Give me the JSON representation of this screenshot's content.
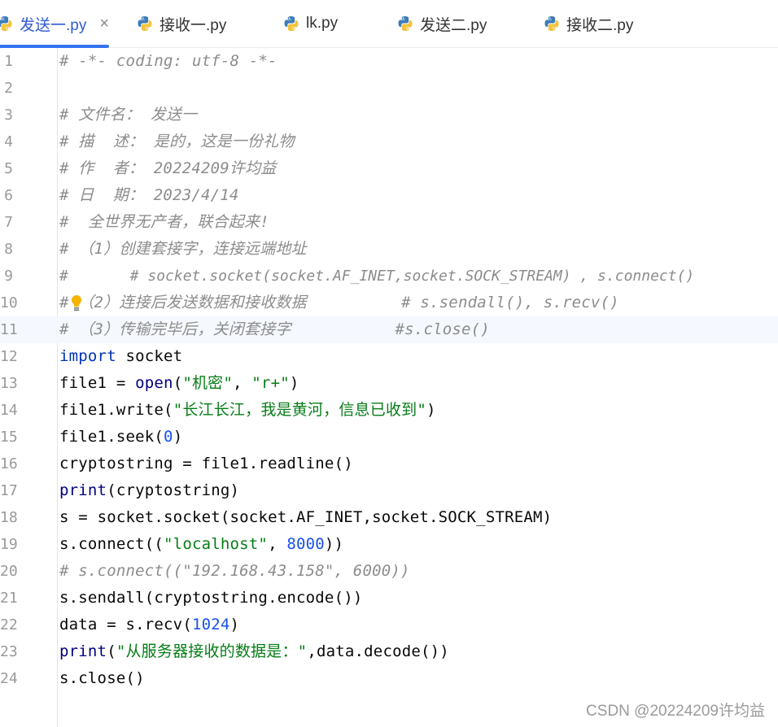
{
  "tabs": [
    {
      "label": "发送一.py",
      "active": true,
      "close": "×"
    },
    {
      "label": "接收一.py",
      "active": false
    },
    {
      "label": "lk.py",
      "active": false
    },
    {
      "label": "发送二.py",
      "active": false
    },
    {
      "label": "接收二.py",
      "active": false
    }
  ],
  "lines": [
    {
      "n": "1",
      "text": "# -*- coding: utf-8 -*-"
    },
    {
      "n": "2",
      "text": ""
    },
    {
      "n": "3",
      "text": "# 文件名： 发送一"
    },
    {
      "n": "4",
      "text": "# 描  述： 是的，这是一份礼物"
    },
    {
      "n": "5",
      "text": "# 作  者： 20224209许均益"
    },
    {
      "n": "6",
      "text": "# 日  期： 2023/4/14"
    },
    {
      "n": "7",
      "text": "#  全世界无产者，联合起来!"
    },
    {
      "n": "8",
      "text": "# （1）创建套接字，连接远端地址"
    },
    {
      "n": "9",
      "text": "#       # socket.socket(socket.AF_INET,socket.SOCK_STREAM) , s.connect()"
    },
    {
      "n": "10",
      "text": "# （2）连接后发送数据和接收数据          # s.sendall(), s.recv()"
    },
    {
      "n": "11",
      "text": "# （3）传输完毕后，关闭套接字           #s.close()"
    },
    {
      "n": "12",
      "text": "import socket"
    },
    {
      "n": "13",
      "text": "file1 = open(\"机密\", \"r+\")"
    },
    {
      "n": "14",
      "text": "file1.write(\"长江长江，我是黄河，信息已收到\")"
    },
    {
      "n": "15",
      "text": "file1.seek(0)"
    },
    {
      "n": "16",
      "text": "cryptostring = file1.readline()"
    },
    {
      "n": "17",
      "text": "print(cryptostring)"
    },
    {
      "n": "18",
      "text": "s = socket.socket(socket.AF_INET,socket.SOCK_STREAM)"
    },
    {
      "n": "19",
      "text": "s.connect((\"localhost\", 8000))"
    },
    {
      "n": "20",
      "text": "# s.connect((\"192.168.43.158\", 6000))"
    },
    {
      "n": "21",
      "text": "s.sendall(cryptostring.encode())"
    },
    {
      "n": "22",
      "text": "data = s.recv(1024)"
    },
    {
      "n": "23",
      "text": "print(\"从服务器接收的数据是：\",data.decode())"
    },
    {
      "n": "24",
      "text": "s.close()"
    }
  ],
  "watermark": "CSDN @20224209许均益",
  "colors": {
    "comment": "#8c8c8c",
    "keyword": "#0033b3",
    "string": "#067d17",
    "number": "#1750eb",
    "active_tab": "#3574f0"
  },
  "icons": {
    "tab_icon": "python-icon",
    "gutter_hint": "lightbulb-icon"
  }
}
